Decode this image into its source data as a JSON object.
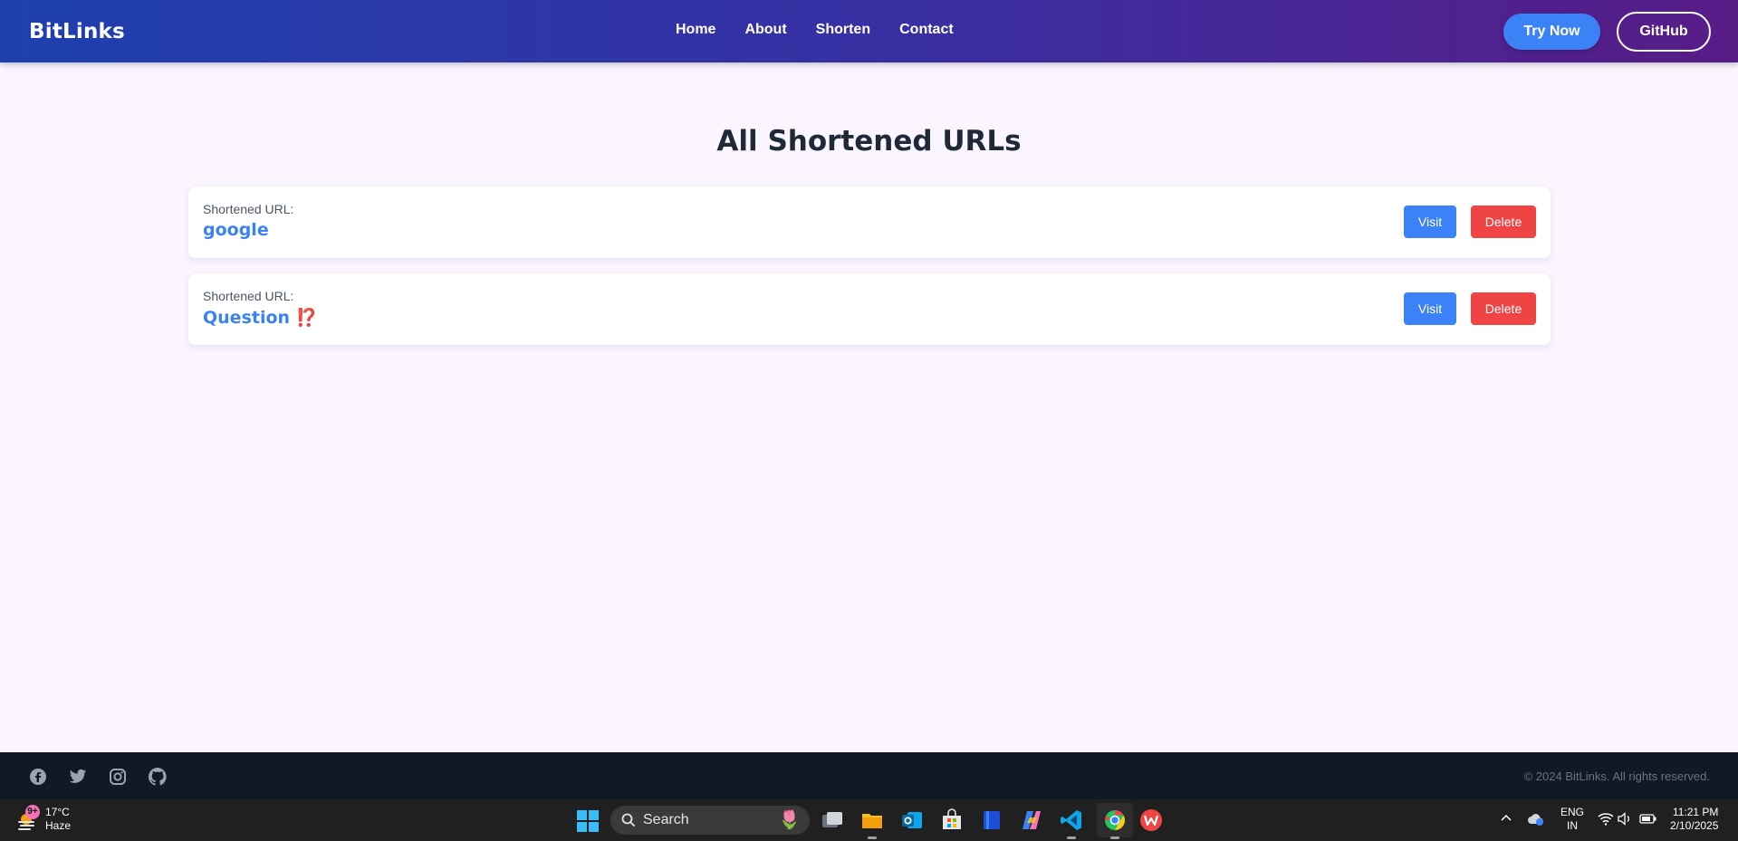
{
  "navbar": {
    "brand": "BitLinks",
    "links": [
      "Home",
      "About",
      "Shorten",
      "Contact"
    ],
    "try_now": "Try Now",
    "github": "GitHub"
  },
  "main": {
    "title": "All Shortened URLs",
    "cards": [
      {
        "label": "Shortened URL:",
        "text": "google",
        "emoji": "",
        "visit": "Visit",
        "delete": "Delete"
      },
      {
        "label": "Shortened URL:",
        "text": "Question",
        "emoji": "⁉️",
        "visit": "Visit",
        "delete": "Delete"
      }
    ]
  },
  "footer": {
    "social_icons": [
      "facebook-icon",
      "twitter-icon",
      "instagram-icon",
      "github-icon"
    ],
    "copyright": "© 2024 BitLinks. All rights reserved."
  },
  "taskbar": {
    "weather_badge": "9+",
    "temperature": "17°C",
    "condition": "Haze",
    "search": "Search",
    "lang_line1": "ENG",
    "lang_line2": "IN",
    "time": "11:21 PM",
    "date": "2/10/2025"
  },
  "colors": {
    "primary": "#3b82f6",
    "danger": "#ef4444",
    "footer_bg": "#111827",
    "page_bg": "#faf5ff"
  }
}
